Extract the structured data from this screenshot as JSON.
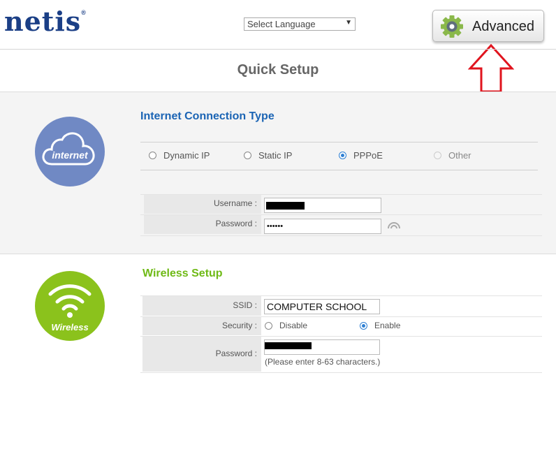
{
  "header": {
    "logo_text": "netis",
    "logo_mark": "®",
    "language_select": "Select Language",
    "advanced_button": "Advanced",
    "page_title": "Quick Setup"
  },
  "internet": {
    "icon_label": "internet",
    "section_title": "Internet Connection Type",
    "connection_types": [
      {
        "label": "Dynamic IP",
        "selected": false,
        "disabled": false
      },
      {
        "label": "Static IP",
        "selected": false,
        "disabled": false
      },
      {
        "label": "PPPoE",
        "selected": true,
        "disabled": false
      },
      {
        "label": "Other",
        "selected": false,
        "disabled": true
      }
    ],
    "username_label": "Username :",
    "password_label": "Password :",
    "password_masked": "••••••"
  },
  "wireless": {
    "icon_label": "Wireless",
    "section_title": "Wireless Setup",
    "ssid_label": "SSID :",
    "ssid_value": "COMPUTER SCHOOL",
    "security_label": "Security :",
    "security_options": [
      {
        "label": "Disable",
        "selected": false
      },
      {
        "label": "Enable",
        "selected": true
      }
    ],
    "password_label": "Password :",
    "password_hint": "(Please enter 8-63 characters.)"
  },
  "colors": {
    "internet_blue": "#7089c4",
    "wireless_green": "#8bc21c",
    "title_blue": "#1b64b4",
    "title_green": "#6fba16",
    "arrow_red": "#e0141e"
  }
}
